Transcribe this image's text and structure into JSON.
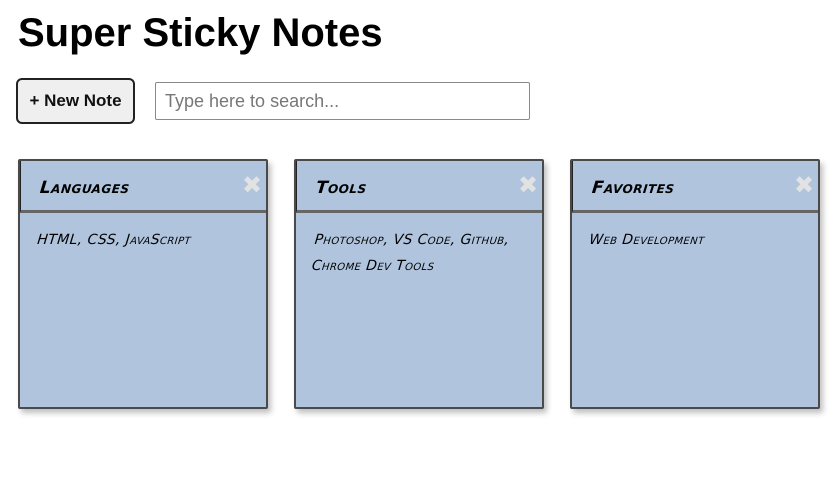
{
  "app": {
    "title": "Super Sticky Notes"
  },
  "toolbar": {
    "new_note_label": "+ New Note",
    "search_placeholder": "Type here to search...",
    "search_value": ""
  },
  "notes": [
    {
      "title": "Languages",
      "body": "HTML, CSS, JavaScript",
      "close_glyph": "✖"
    },
    {
      "title": "Tools",
      "body": "Photoshop, VS Code, Github, Chrome Dev Tools",
      "close_glyph": "✖"
    },
    {
      "title": "Favorites",
      "body": "Web Development",
      "close_glyph": "✖"
    }
  ],
  "colors": {
    "note_background": "#b0c4de",
    "close_icon": "#e2e2e2",
    "button_background": "#efefef"
  },
  "icons": {
    "close": "close-icon"
  }
}
